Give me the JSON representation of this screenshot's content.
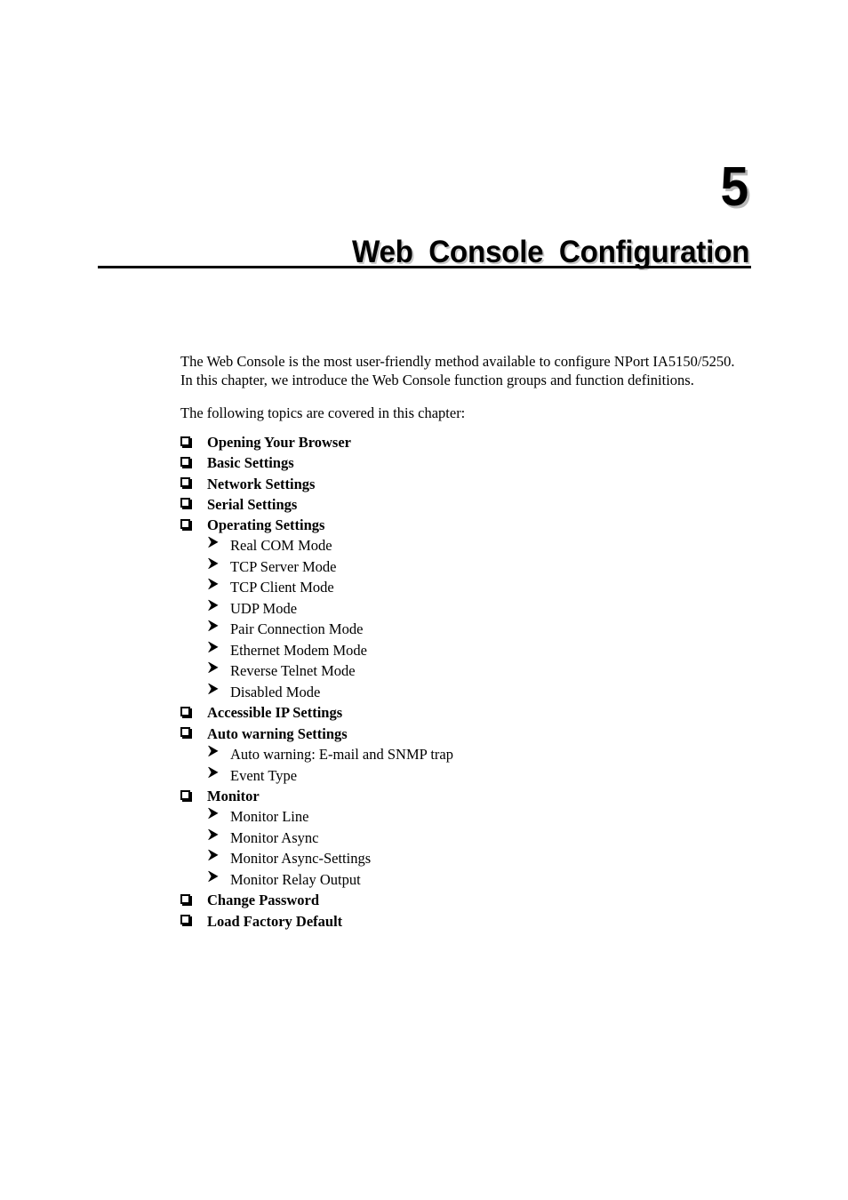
{
  "chapter": {
    "number": "5",
    "title": "Web  Console  Configuration"
  },
  "intro": {
    "paragraph1": "The Web Console is the most user-friendly method available to configure NPort IA5150/5250. In this chapter, we introduce the Web Console function groups and function definitions.",
    "paragraph2": "The following topics are covered in this chapter:"
  },
  "bullets": {
    "box_glyph": "box-bullet-icon",
    "arrow_glyph": "arrow-bullet-icon"
  },
  "topics": [
    {
      "label": "Opening Your Browser",
      "children": []
    },
    {
      "label": "Basic Settings",
      "children": []
    },
    {
      "label": "Network Settings",
      "children": []
    },
    {
      "label": "Serial Settings",
      "children": []
    },
    {
      "label": "Operating Settings",
      "children": [
        "Real COM Mode",
        "TCP Server Mode",
        "TCP Client Mode",
        "UDP Mode",
        "Pair Connection Mode",
        "Ethernet Modem Mode",
        "Reverse Telnet Mode",
        "Disabled Mode"
      ]
    },
    {
      "label": "Accessible IP Settings",
      "children": []
    },
    {
      "label": "Auto warning Settings",
      "children": [
        "Auto warning: E-mail and SNMP trap",
        "Event Type"
      ]
    },
    {
      "label": "Monitor",
      "children": [
        "Monitor Line",
        "Monitor Async",
        "Monitor Async-Settings",
        "Monitor Relay Output"
      ]
    },
    {
      "label": "Change Password",
      "children": []
    },
    {
      "label": "Load Factory Default",
      "children": []
    }
  ]
}
